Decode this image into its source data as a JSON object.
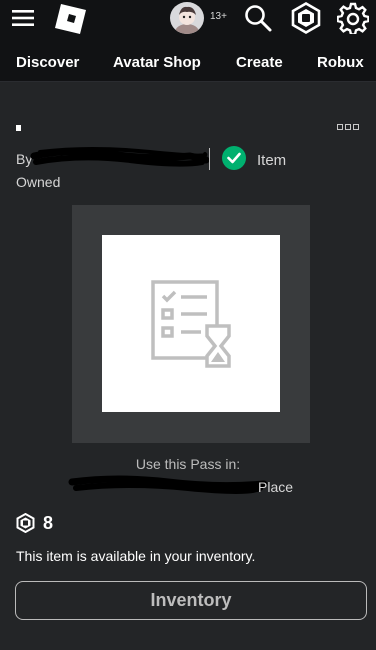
{
  "header": {
    "age_badge": "13+",
    "icons": [
      "hamburger-icon",
      "roblox-logo",
      "avatar",
      "search-icon",
      "robux-icon",
      "gear-icon"
    ]
  },
  "nav": {
    "items": [
      {
        "label": "Discover"
      },
      {
        "label": "Avatar Shop"
      },
      {
        "label": "Create"
      },
      {
        "label": "Robux"
      }
    ]
  },
  "item": {
    "by_prefix": "By",
    "type_label": "Item",
    "owned_label": "Owned",
    "use_pass_label": "Use this Pass in:",
    "place_suffix": "Place",
    "price": "8",
    "availability": "This item is available in your inventory.",
    "inventory_button": "Inventory"
  },
  "colors": {
    "background": "#111214",
    "panel": "#232527",
    "check": "#00b06f"
  }
}
